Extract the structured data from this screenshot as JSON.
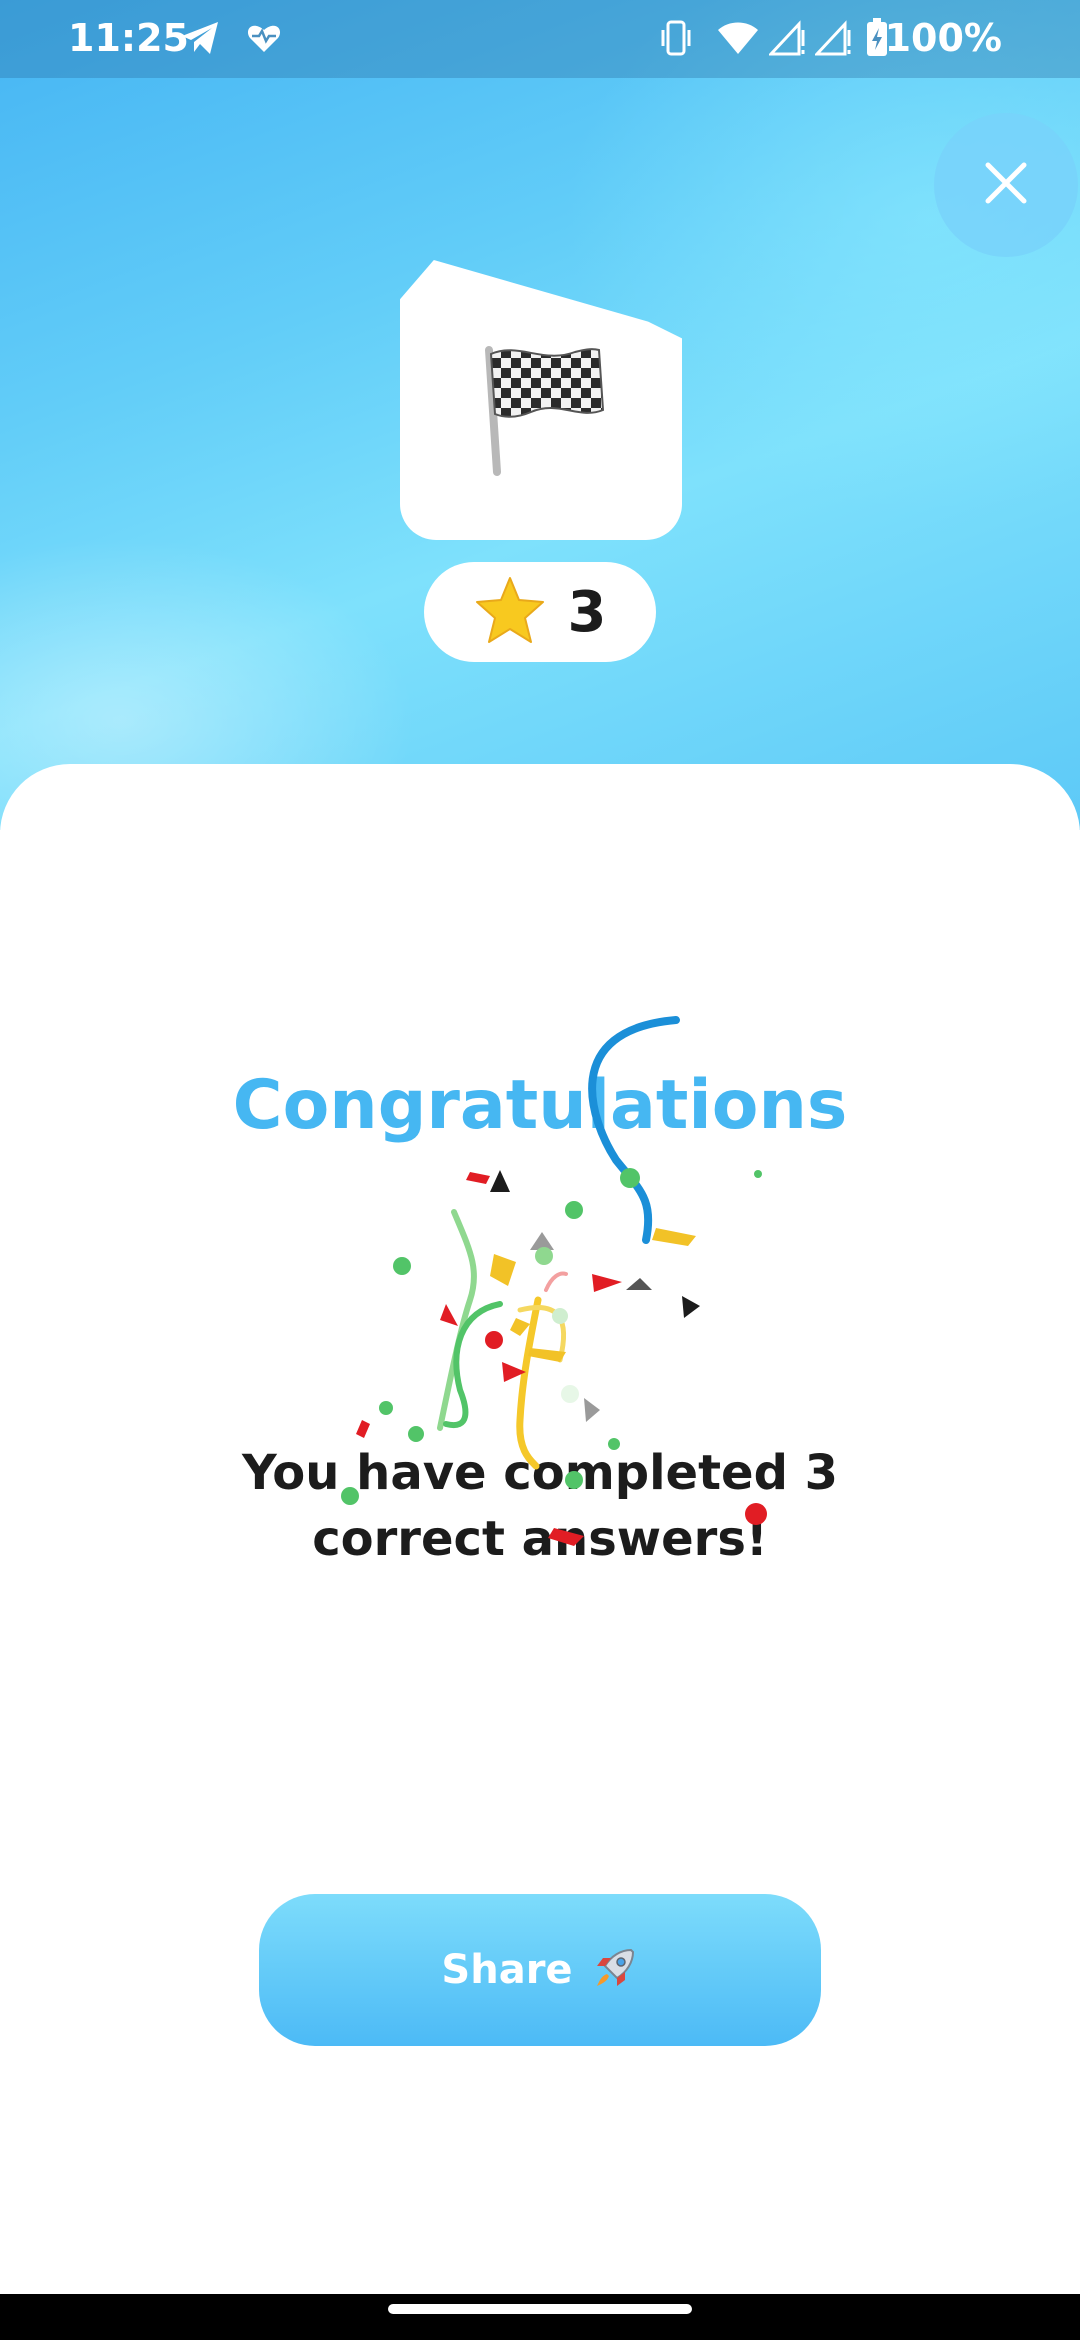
{
  "status_bar": {
    "time": "11:25",
    "battery": "100%",
    "icons": [
      "telegram-icon",
      "heart-pulse-icon",
      "vibrate-icon",
      "wifi-icon",
      "signal-icon",
      "signal-icon",
      "battery-charging-icon"
    ]
  },
  "header": {
    "close_icon": "close-icon",
    "badge_icon": "checkered-flag-icon",
    "score": {
      "icon": "star-icon",
      "value": "3"
    }
  },
  "result": {
    "title": "Congratulations",
    "message": "You have completed 3 correct answers!"
  },
  "actions": {
    "share_label": "Share",
    "share_icon": "rocket-icon"
  },
  "colors": {
    "accent": "#46b7f2",
    "hero_gradient_start": "#45b4f3",
    "hero_gradient_end": "#7ee1fc",
    "text": "#1c1c1c"
  }
}
